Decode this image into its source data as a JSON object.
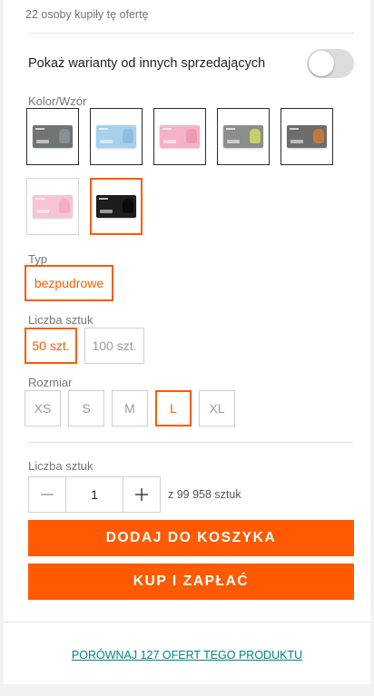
{
  "buyers_text": "22 osoby kupiły tę ofertę",
  "variants_toggle": {
    "label": "Pokaż warianty od innych sprzedających",
    "on": false
  },
  "color": {
    "label": "Kolor/Wzór",
    "swatches": [
      {
        "box_color": "#6f7477",
        "hand_color": "#8a8f92",
        "selected": false
      },
      {
        "box_color": "#a7d0ee",
        "hand_color": "#8fbde0",
        "selected": false
      },
      {
        "box_color": "#f5b2c7",
        "hand_color": "#ee98b3",
        "selected": false
      },
      {
        "box_color": "#8b8e8a",
        "hand_color": "#c4d06a",
        "selected": false
      },
      {
        "box_color": "#6d6d6d",
        "hand_color": "#c27a3c",
        "selected": false
      },
      {
        "box_color": "#f7c4d5",
        "hand_color": "#f3aec4",
        "selected": false
      },
      {
        "box_color": "#1d1d1d",
        "hand_color": "#0b0b0b",
        "selected": true
      }
    ]
  },
  "type": {
    "label": "Typ",
    "options": [
      {
        "label": "bezpudrowe",
        "selected": true
      }
    ]
  },
  "pieces": {
    "label": "Liczba sztuk",
    "options": [
      {
        "label": "50 szt.",
        "selected": true
      },
      {
        "label": "100 szt.",
        "selected": false
      }
    ]
  },
  "size": {
    "label": "Rozmiar",
    "options": [
      {
        "label": "XS",
        "selected": false
      },
      {
        "label": "S",
        "selected": false
      },
      {
        "label": "M",
        "selected": false
      },
      {
        "label": "L",
        "selected": true
      },
      {
        "label": "XL",
        "selected": false
      }
    ]
  },
  "quantity": {
    "label": "Liczba sztuk",
    "value": "1",
    "stock_text": "z 99 958 sztuk"
  },
  "buttons": {
    "add_to_cart": "DODAJ DO KOSZYKA",
    "buy_now": "KUP I ZAPŁAĆ"
  },
  "compare_link": "PORÓWNAJ 127 OFERT TEGO PRODUKTU",
  "colors": {
    "accent": "#ff5a00",
    "link": "#00857a"
  }
}
